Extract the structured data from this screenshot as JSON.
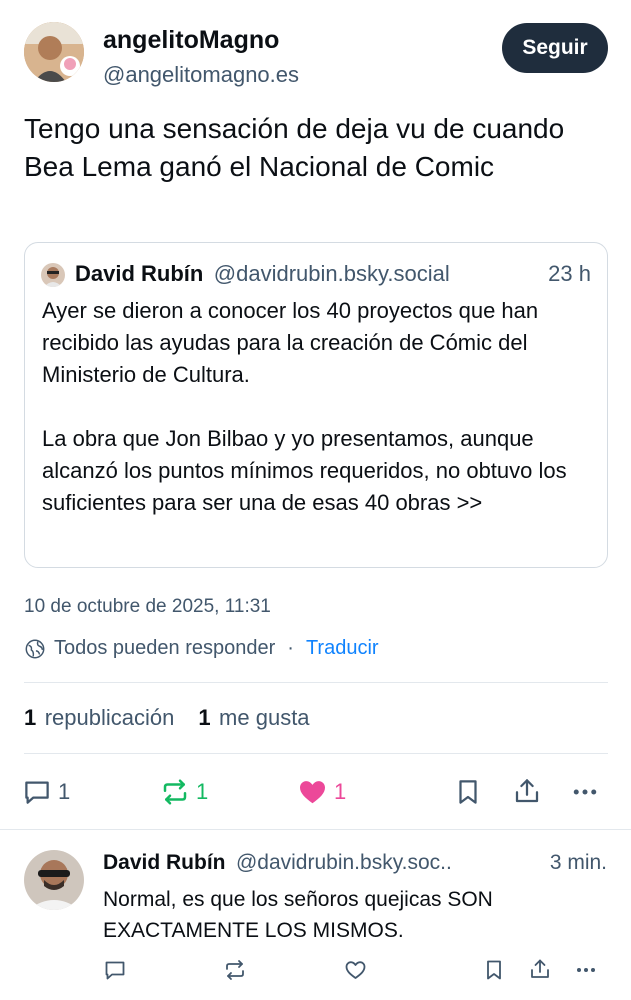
{
  "post": {
    "author": {
      "display_name": "angelitoMagno",
      "handle": "@angelitomagno.es"
    },
    "follow_label": "Seguir",
    "text": "Tengo una sensación de deja vu de cuando Bea Lema ganó el Nacional de Comic",
    "quote": {
      "display_name": "David Rubín",
      "handle": "@davidrubin.bsky.social",
      "time": "23 h",
      "text": "Ayer se dieron a conocer los 40 proyectos que han recibido las ayudas para la creación de Cómic del Ministerio de Cultura.\n\nLa obra que Jon Bilbao y yo presentamos, aunque alcanzó los puntos mínimos requeridos, no obtuvo los suficientes para ser una de esas 40 obras >>"
    },
    "date": "10 de octubre de 2025, 11:31",
    "reply_setting": "Todos pueden responder",
    "separator": "·",
    "translate_label": "Traducir",
    "stats": {
      "reposts_count": "1",
      "reposts_label": "republicación",
      "likes_count": "1",
      "likes_label": "me gusta"
    },
    "actions": {
      "reply_count": "1",
      "repost_count": "1",
      "like_count": "1"
    }
  },
  "reply": {
    "display_name": "David Rubín",
    "handle": "@davidrubin.bsky.soc..",
    "time": "3 min.",
    "text": "Normal, es que los señoros quejicas SON EXACTAMENTE LOS MISMOS."
  },
  "icons": {
    "reply": "speech-bubble-icon",
    "repost": "repost-arrows-icon",
    "like": "heart-icon",
    "bookmark": "bookmark-icon",
    "share": "share-icon",
    "more": "more-dots-icon",
    "reply_setting": "globe-icon"
  },
  "colors": {
    "follow_bg": "#1f2d3d",
    "link": "#1083fe",
    "repost_active": "#13b961",
    "like_active": "#ec4899",
    "muted": "#42576c"
  }
}
